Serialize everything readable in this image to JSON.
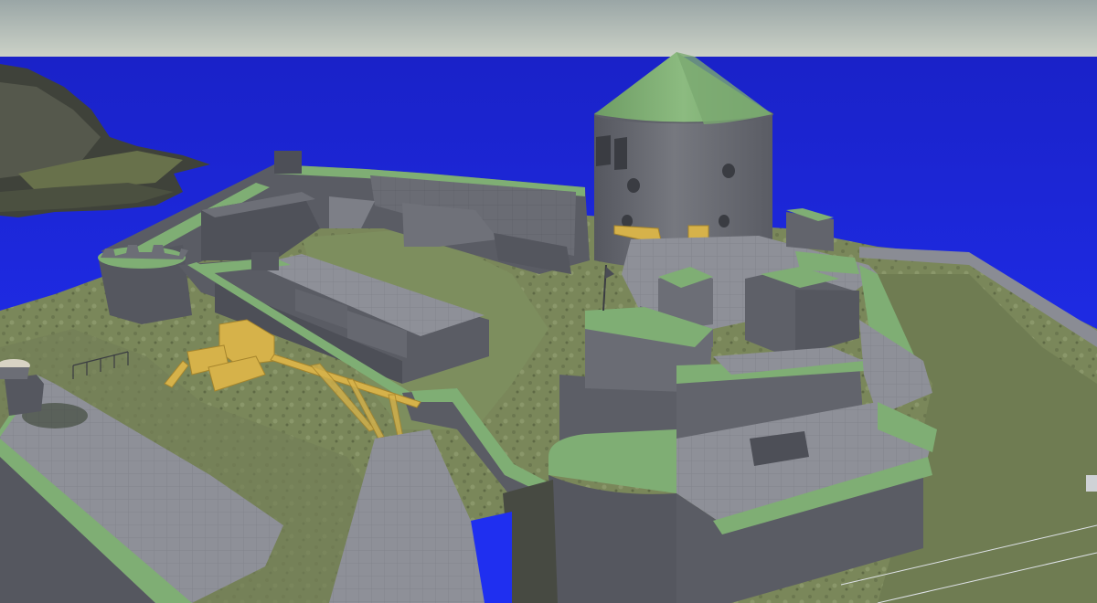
{
  "scene": {
    "kind": "3d-game-level-viewport",
    "subject": "island-fortress",
    "colors": {
      "sky_top": "#9aa6a6",
      "sky_bottom": "#cdd3c8",
      "sea": "#1f2ff0",
      "sea_dark": "#1a22c8",
      "terrain": "#7c8a5c",
      "terrain_dark": "#55603e",
      "wall": "#6c6e76",
      "wall_dark": "#4d4f57",
      "wall_light": "#8a8c94",
      "roof_green": "#7fae74",
      "floor": "#8e9098",
      "timber": "#d6b24a",
      "rock": "#4a4d44"
    }
  }
}
